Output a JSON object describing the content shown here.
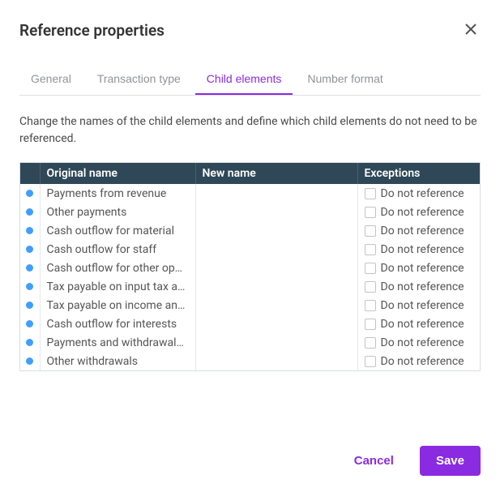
{
  "dialog": {
    "title": "Reference properties",
    "description": "Change the names of the child elements and define which child elements do not need to be referenced."
  },
  "tabs": [
    {
      "label": "General",
      "active": false
    },
    {
      "label": "Transaction type",
      "active": false
    },
    {
      "label": "Child elements",
      "active": true
    },
    {
      "label": "Number format",
      "active": false
    }
  ],
  "table": {
    "headers": {
      "original": "Original name",
      "new": "New name",
      "exceptions": "Exceptions"
    },
    "exception_label": "Do not reference",
    "rows": [
      {
        "original": "Payments from revenue",
        "new": ""
      },
      {
        "original": "Other payments",
        "new": ""
      },
      {
        "original": "Cash outflow for material",
        "new": ""
      },
      {
        "original": "Cash outflow for staff",
        "new": ""
      },
      {
        "original": "Cash outflow for other op…",
        "new": ""
      },
      {
        "original": "Tax payable on input tax a…",
        "new": ""
      },
      {
        "original": "Tax payable on income an…",
        "new": ""
      },
      {
        "original": "Cash outflow for interests",
        "new": ""
      },
      {
        "original": "Payments and withdrawal…",
        "new": ""
      },
      {
        "original": "Other withdrawals",
        "new": ""
      }
    ]
  },
  "buttons": {
    "cancel": "Cancel",
    "save": "Save"
  }
}
